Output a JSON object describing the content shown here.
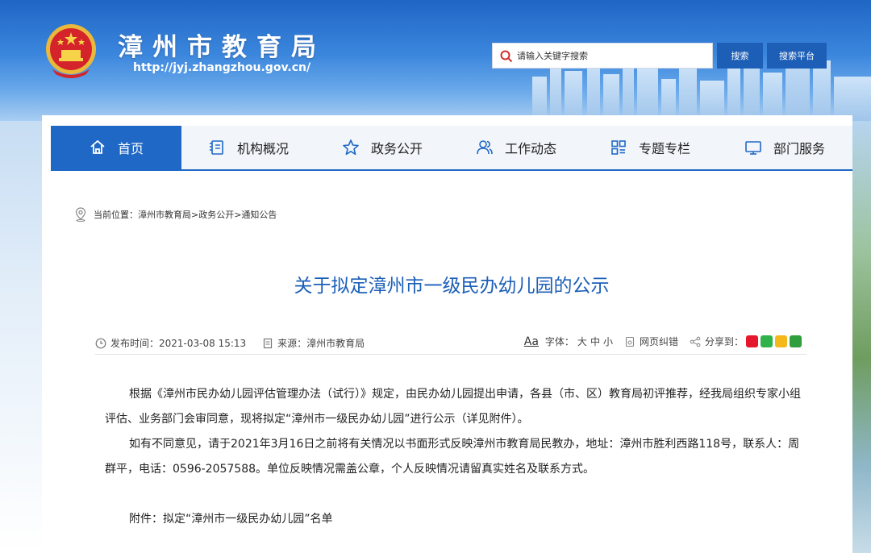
{
  "header": {
    "title": "漳州市教育局",
    "url": "http://jyj.zhangzhou.gov.cn/",
    "search_placeholder": "请输入关键字搜索",
    "search_button": "搜索",
    "platform_button": "搜索平台"
  },
  "nav": {
    "items": [
      {
        "label": "首页",
        "icon": "home-icon"
      },
      {
        "label": "机构概况",
        "icon": "document-icon"
      },
      {
        "label": "政务公开",
        "icon": "star-icon"
      },
      {
        "label": "工作动态",
        "icon": "people-icon"
      },
      {
        "label": "专题专栏",
        "icon": "grid-icon"
      },
      {
        "label": "部门服务",
        "icon": "monitor-icon"
      }
    ]
  },
  "breadcrumb": {
    "text": "当前位置：漳州市教育局>政务公开>通知公告"
  },
  "article": {
    "title": "关于拟定漳州市一级民办幼儿园的公示",
    "meta": {
      "publish": "发布时间：2021-03-08 15:13",
      "source": "来源：漳州市教育局",
      "aa": "Aa",
      "font_label": "字体：",
      "font_large": "大",
      "font_medium": "中",
      "font_small": "小",
      "correct": "网页纠错",
      "share": "分享到："
    },
    "paragraphs": [
      "根据《漳州市民办幼儿园评估管理办法（试行）》规定，由民办幼儿园提出申请，各县（市、区）教育局初评推荐，经我局组织专家小组评估、业务部门会审同意，现将拟定“漳州市一级民办幼儿园”进行公示（详见附件）。",
      "如有不同意见，请于2021年3月16日之前将有关情况以书面形式反映漳州市教育局民教办，地址：漳州市胜利西路118号，联系人：周群平，电话：0596-2057588。单位反映情况需盖公章，个人反映情况请留真实姓名及联系方式。",
      "附件：拟定“漳州市一级民办幼儿园”名单"
    ]
  },
  "colors": {
    "brand_blue": "#1f68c6",
    "title_blue": "#1c5fb8",
    "button_blue": "#1d5fb7"
  }
}
